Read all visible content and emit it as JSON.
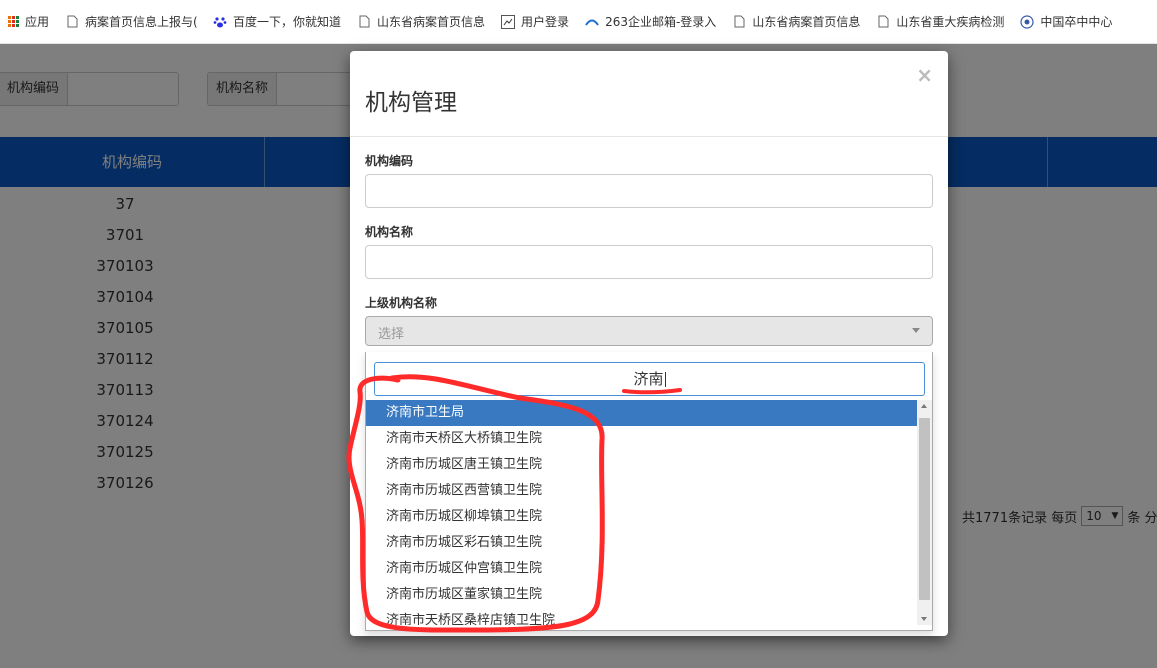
{
  "bookmarks": [
    {
      "icon": "apps-icon",
      "label": "应用"
    },
    {
      "icon": "page-icon",
      "label": "病案首页信息上报与("
    },
    {
      "icon": "baidu-paw-icon",
      "label": "百度一下，你就知道"
    },
    {
      "icon": "page-icon",
      "label": "山东省病案首页信息"
    },
    {
      "icon": "user-login-icon",
      "label": "用户登录"
    },
    {
      "icon": "mail-263-icon",
      "label": "263企业邮箱-登录入"
    },
    {
      "icon": "page-icon",
      "label": "山东省病案首页信息"
    },
    {
      "icon": "page-icon",
      "label": "山东省重大疾病检测"
    },
    {
      "icon": "globe-icon",
      "label": "中国卒中中心"
    }
  ],
  "page": {
    "filters": [
      {
        "label": "机构编码"
      },
      {
        "label": "机构名称"
      }
    ],
    "table_header": "机构编码",
    "rows": [
      "37",
      "3701",
      "370103",
      "370104",
      "370105",
      "370112",
      "370113",
      "370124",
      "370125",
      "370126"
    ],
    "pager": {
      "total_text": "共1771条记录 每页",
      "page_size": "10",
      "suffix": "条 分"
    }
  },
  "modal": {
    "title": "机构管理",
    "close_symbol": "×",
    "fields": {
      "code_label": "机构编码",
      "name_label": "机构名称",
      "parent_label": "上级机构名称",
      "parent_placeholder": "选择"
    }
  },
  "dropdown": {
    "search_value": "济南",
    "options": [
      "济南市卫生局",
      "济南市天桥区大桥镇卫生院",
      "济南市历城区唐王镇卫生院",
      "济南市历城区西营镇卫生院",
      "济南市历城区柳埠镇卫生院",
      "济南市历城区彩石镇卫生院",
      "济南市历城区仲宫镇卫生院",
      "济南市历城区董家镇卫生院",
      "济南市天桥区桑梓店镇卫生院"
    ],
    "selected_index": 0
  },
  "colors": {
    "table_header_bg": "#0a5bc6",
    "selected_option_bg": "#3879c1",
    "annotation": "#ff2a2a"
  }
}
